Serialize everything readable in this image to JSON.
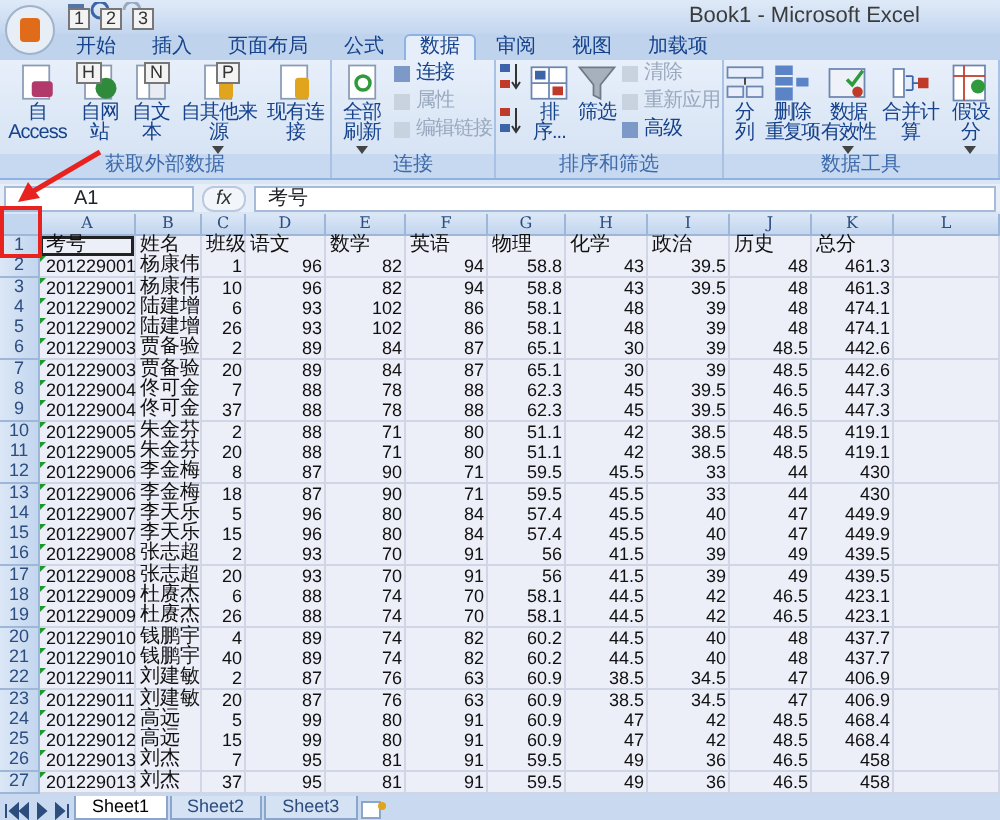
{
  "window": {
    "title": "Book1 - Microsoft Excel"
  },
  "keytips": [
    {
      "label": "1"
    },
    {
      "label": "2"
    },
    {
      "label": "3"
    },
    {
      "label": "H"
    },
    {
      "label": "N"
    },
    {
      "label": "P"
    }
  ],
  "tabs": [
    {
      "label": "开始",
      "selected": false
    },
    {
      "label": "插入",
      "selected": false
    },
    {
      "label": "页面布局",
      "selected": false
    },
    {
      "label": "公式",
      "selected": false
    },
    {
      "label": "数据",
      "selected": true
    },
    {
      "label": "审阅",
      "selected": false
    },
    {
      "label": "视图",
      "selected": false
    },
    {
      "label": "加载项",
      "selected": false
    }
  ],
  "ribbon": {
    "groups": [
      {
        "label": "获取外部数据",
        "items": [
          {
            "kind": "large",
            "label": "自 Access",
            "dropdown": false
          },
          {
            "kind": "large",
            "label": "自网站",
            "dropdown": false
          },
          {
            "kind": "large",
            "label": "自文本",
            "dropdown": false
          },
          {
            "kind": "large",
            "label": "自其他来源",
            "dropdown": true
          },
          {
            "kind": "large",
            "label": "现有连接",
            "dropdown": false
          }
        ]
      },
      {
        "label": "连接",
        "items": [
          {
            "kind": "large",
            "label": "全部刷新",
            "dropdown": true
          },
          {
            "kind": "stack",
            "items": [
              {
                "label": "连接",
                "disabled": false
              },
              {
                "label": "属性",
                "disabled": true
              },
              {
                "label": "编辑链接",
                "disabled": true
              }
            ]
          }
        ]
      },
      {
        "label": "排序和筛选",
        "items": [
          {
            "kind": "sort-pair"
          },
          {
            "kind": "large",
            "label": "排序...",
            "dropdown": false
          },
          {
            "kind": "large",
            "label": "筛选",
            "dropdown": false
          },
          {
            "kind": "stack",
            "items": [
              {
                "label": "清除",
                "disabled": true
              },
              {
                "label": "重新应用",
                "disabled": true
              },
              {
                "label": "高级",
                "disabled": false
              }
            ]
          }
        ]
      },
      {
        "label": "数据工具",
        "items": [
          {
            "kind": "large",
            "label": "分列",
            "dropdown": false
          },
          {
            "kind": "large",
            "label_lines": [
              "删除",
              "重复项"
            ],
            "dropdown": false
          },
          {
            "kind": "large",
            "label_lines": [
              "数据",
              "有效性"
            ],
            "dropdown": true
          },
          {
            "kind": "large",
            "label": "合并计算",
            "dropdown": false
          },
          {
            "kind": "large",
            "label": "假设分",
            "dropdown": true
          }
        ]
      }
    ]
  },
  "formula_bar": {
    "name_box": "A1",
    "function_label": "fx",
    "formula": "考号"
  },
  "columns": [
    {
      "letter": "A",
      "kind": "text-number"
    },
    {
      "letter": "B",
      "kind": "text"
    },
    {
      "letter": "C",
      "kind": "number"
    },
    {
      "letter": "D",
      "kind": "number"
    },
    {
      "letter": "E",
      "kind": "number"
    },
    {
      "letter": "F",
      "kind": "number"
    },
    {
      "letter": "G",
      "kind": "number"
    },
    {
      "letter": "H",
      "kind": "number"
    },
    {
      "letter": "I",
      "kind": "number"
    },
    {
      "letter": "J",
      "kind": "number"
    },
    {
      "letter": "K",
      "kind": "number"
    },
    {
      "letter": "L",
      "kind": "number"
    }
  ],
  "rows": [
    {
      "number": "1",
      "kind": "header",
      "cells": [
        "考号",
        "姓名",
        "班级",
        "语文",
        "数学",
        "英语",
        "物理",
        "化学",
        "政治",
        "历史",
        "总分"
      ]
    },
    {
      "number": "2",
      "kind": "data",
      "cells": [
        "201229001",
        "杨康伟",
        "1",
        "96",
        "82",
        "94",
        "58.8",
        "43",
        "39.5",
        "48",
        "461.3"
      ]
    },
    {
      "number": "3",
      "kind": "data",
      "cells": [
        "201229001",
        "杨康伟",
        "10",
        "96",
        "82",
        "94",
        "58.8",
        "43",
        "39.5",
        "48",
        "461.3"
      ]
    },
    {
      "number": "4",
      "kind": "data",
      "cells": [
        "201229002",
        "陆建增",
        "6",
        "93",
        "102",
        "86",
        "58.1",
        "48",
        "39",
        "48",
        "474.1"
      ]
    },
    {
      "number": "5",
      "kind": "data",
      "cells": [
        "201229002",
        "陆建增",
        "26",
        "93",
        "102",
        "86",
        "58.1",
        "48",
        "39",
        "48",
        "474.1"
      ]
    },
    {
      "number": "6",
      "kind": "data",
      "cells": [
        "201229003",
        "贾备验",
        "2",
        "89",
        "84",
        "87",
        "65.1",
        "30",
        "39",
        "48.5",
        "442.6"
      ]
    },
    {
      "number": "7",
      "kind": "data",
      "cells": [
        "201229003",
        "贾备验",
        "20",
        "89",
        "84",
        "87",
        "65.1",
        "30",
        "39",
        "48.5",
        "442.6"
      ]
    },
    {
      "number": "8",
      "kind": "data",
      "cells": [
        "201229004",
        "佟可金",
        "7",
        "88",
        "78",
        "88",
        "62.3",
        "45",
        "39.5",
        "46.5",
        "447.3"
      ]
    },
    {
      "number": "9",
      "kind": "data",
      "cells": [
        "201229004",
        "佟可金",
        "37",
        "88",
        "78",
        "88",
        "62.3",
        "45",
        "39.5",
        "46.5",
        "447.3"
      ]
    },
    {
      "number": "10",
      "kind": "data",
      "cells": [
        "201229005",
        "朱金芬",
        "2",
        "88",
        "71",
        "80",
        "51.1",
        "42",
        "38.5",
        "48.5",
        "419.1"
      ]
    },
    {
      "number": "11",
      "kind": "data",
      "cells": [
        "201229005",
        "朱金芬",
        "20",
        "88",
        "71",
        "80",
        "51.1",
        "42",
        "38.5",
        "48.5",
        "419.1"
      ]
    },
    {
      "number": "12",
      "kind": "data",
      "cells": [
        "201229006",
        "李金梅",
        "8",
        "87",
        "90",
        "71",
        "59.5",
        "45.5",
        "33",
        "44",
        "430"
      ]
    },
    {
      "number": "13",
      "kind": "data",
      "cells": [
        "201229006",
        "李金梅",
        "18",
        "87",
        "90",
        "71",
        "59.5",
        "45.5",
        "33",
        "44",
        "430"
      ]
    },
    {
      "number": "14",
      "kind": "data",
      "cells": [
        "201229007",
        "李天乐",
        "5",
        "96",
        "80",
        "84",
        "57.4",
        "45.5",
        "40",
        "47",
        "449.9"
      ]
    },
    {
      "number": "15",
      "kind": "data",
      "cells": [
        "201229007",
        "李天乐",
        "15",
        "96",
        "80",
        "84",
        "57.4",
        "45.5",
        "40",
        "47",
        "449.9"
      ]
    },
    {
      "number": "16",
      "kind": "data",
      "cells": [
        "201229008",
        "张志超",
        "2",
        "93",
        "70",
        "91",
        "56",
        "41.5",
        "39",
        "49",
        "439.5"
      ]
    },
    {
      "number": "17",
      "kind": "data",
      "cells": [
        "201229008",
        "张志超",
        "20",
        "93",
        "70",
        "91",
        "56",
        "41.5",
        "39",
        "49",
        "439.5"
      ]
    },
    {
      "number": "18",
      "kind": "data",
      "cells": [
        "201229009",
        "杜赓杰",
        "6",
        "88",
        "74",
        "70",
        "58.1",
        "44.5",
        "42",
        "46.5",
        "423.1"
      ]
    },
    {
      "number": "19",
      "kind": "data",
      "cells": [
        "201229009",
        "杜赓杰",
        "26",
        "88",
        "74",
        "70",
        "58.1",
        "44.5",
        "42",
        "46.5",
        "423.1"
      ]
    },
    {
      "number": "20",
      "kind": "data",
      "cells": [
        "201229010",
        "钱鹏宇",
        "4",
        "89",
        "74",
        "82",
        "60.2",
        "44.5",
        "40",
        "48",
        "437.7"
      ]
    },
    {
      "number": "21",
      "kind": "data",
      "cells": [
        "201229010",
        "钱鹏宇",
        "40",
        "89",
        "74",
        "82",
        "60.2",
        "44.5",
        "40",
        "48",
        "437.7"
      ]
    },
    {
      "number": "22",
      "kind": "data",
      "cells": [
        "201229011",
        "刘建敏",
        "2",
        "87",
        "76",
        "63",
        "60.9",
        "38.5",
        "34.5",
        "47",
        "406.9"
      ]
    },
    {
      "number": "23",
      "kind": "data",
      "cells": [
        "201229011",
        "刘建敏",
        "20",
        "87",
        "76",
        "63",
        "60.9",
        "38.5",
        "34.5",
        "47",
        "406.9"
      ]
    },
    {
      "number": "24",
      "kind": "data",
      "cells": [
        "201229012",
        "高远",
        "5",
        "99",
        "80",
        "91",
        "60.9",
        "47",
        "42",
        "48.5",
        "468.4"
      ]
    },
    {
      "number": "25",
      "kind": "data",
      "cells": [
        "201229012",
        "高远",
        "15",
        "99",
        "80",
        "91",
        "60.9",
        "47",
        "42",
        "48.5",
        "468.4"
      ]
    },
    {
      "number": "26",
      "kind": "data",
      "cells": [
        "201229013",
        "刘杰",
        "7",
        "95",
        "81",
        "91",
        "59.5",
        "49",
        "36",
        "46.5",
        "458"
      ]
    },
    {
      "number": "27",
      "kind": "data",
      "cells": [
        "201229013",
        "刘杰",
        "37",
        "95",
        "81",
        "91",
        "59.5",
        "49",
        "36",
        "46.5",
        "458"
      ]
    }
  ],
  "sheet_tabs": [
    {
      "label": "Sheet1",
      "selected": true
    },
    {
      "label": "Sheet2",
      "selected": false
    },
    {
      "label": "Sheet3",
      "selected": false
    }
  ]
}
